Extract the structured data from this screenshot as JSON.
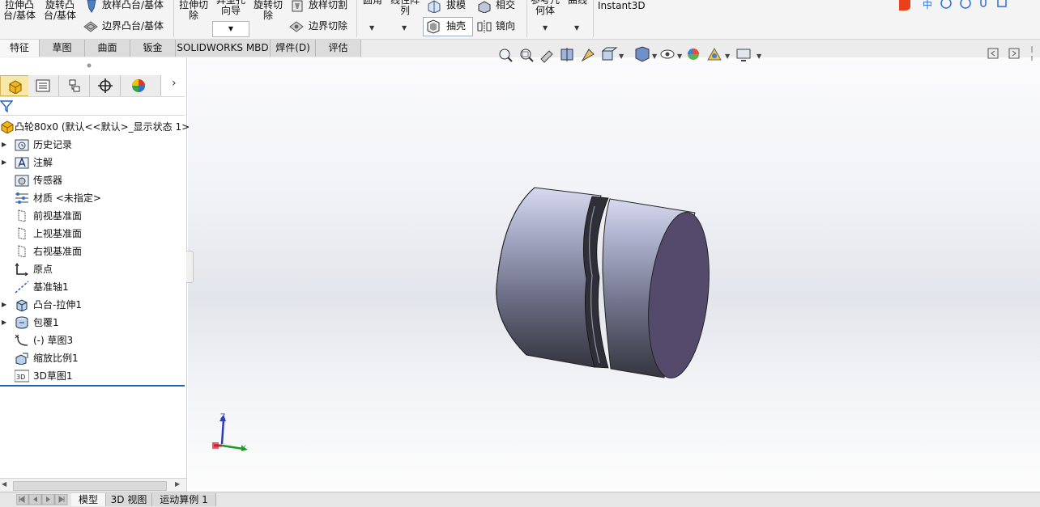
{
  "ribbon": {
    "extrude_boss": "拉伸凸\n台/基体",
    "revolve_boss": "旋转凸\n台/基体",
    "loft_boss": "放样凸台/基体",
    "boundary_boss": "边界凸台/基体",
    "extrude_cut": "拉伸切\n除",
    "hole_wizard": "异型孔\n向导",
    "revolve_cut": "旋转切\n除",
    "loft_cut": "放样切割",
    "boundary_cut": "边界切除",
    "fillet": "圆角",
    "linear_pattern": "线性阵\n列",
    "draft": "拔模",
    "shell": "抽壳",
    "intersect": "相交",
    "mirror": "镜向",
    "ref_geometry": "参考几\n何体",
    "curves": "曲线",
    "instant3d": "Instant3D",
    "ime_label": "中"
  },
  "tabs": [
    {
      "label": "特征"
    },
    {
      "label": "草图"
    },
    {
      "label": "曲面"
    },
    {
      "label": "钣金"
    },
    {
      "label": "SOLIDWORKS MBD"
    },
    {
      "label": "焊件(D)"
    },
    {
      "label": "评估"
    }
  ],
  "tree": {
    "root": "凸轮80x0  (默认<<默认>_显示状态 1>",
    "items": [
      {
        "label": "历史记录",
        "icon": "history-icon",
        "arrow": true
      },
      {
        "label": "注解",
        "icon": "annotation-icon",
        "arrow": true
      },
      {
        "label": "传感器",
        "icon": "sensor-icon",
        "arrow": false
      },
      {
        "label": "材质 <未指定>",
        "icon": "material-icon",
        "arrow": false
      },
      {
        "label": "前视基准面",
        "icon": "plane-icon",
        "arrow": false
      },
      {
        "label": "上视基准面",
        "icon": "plane-icon",
        "arrow": false
      },
      {
        "label": "右视基准面",
        "icon": "plane-icon",
        "arrow": false
      },
      {
        "label": "原点",
        "icon": "origin-icon",
        "arrow": false
      },
      {
        "label": "基准轴1",
        "icon": "axis-icon",
        "arrow": false
      },
      {
        "label": "凸台-拉伸1",
        "icon": "extrude-feature-icon",
        "arrow": true
      },
      {
        "label": "包覆1",
        "icon": "wrap-feature-icon",
        "arrow": true
      },
      {
        "label": "(-) 草图3",
        "icon": "sketch-icon",
        "arrow": false
      },
      {
        "label": "缩放比例1",
        "icon": "scale-feature-icon",
        "arrow": false
      },
      {
        "label": "3D草图1",
        "icon": "3d-sketch-icon",
        "arrow": false
      }
    ]
  },
  "bottom_tabs": [
    {
      "label": "模型"
    },
    {
      "label": "3D 视图"
    },
    {
      "label": "运动算例 1"
    }
  ],
  "triad": {
    "x": "Y",
    "z": "Z"
  },
  "colors": {
    "accent": "#1a5fb4",
    "part_face": "#9ea3c4",
    "part_end": "#544a6b"
  }
}
